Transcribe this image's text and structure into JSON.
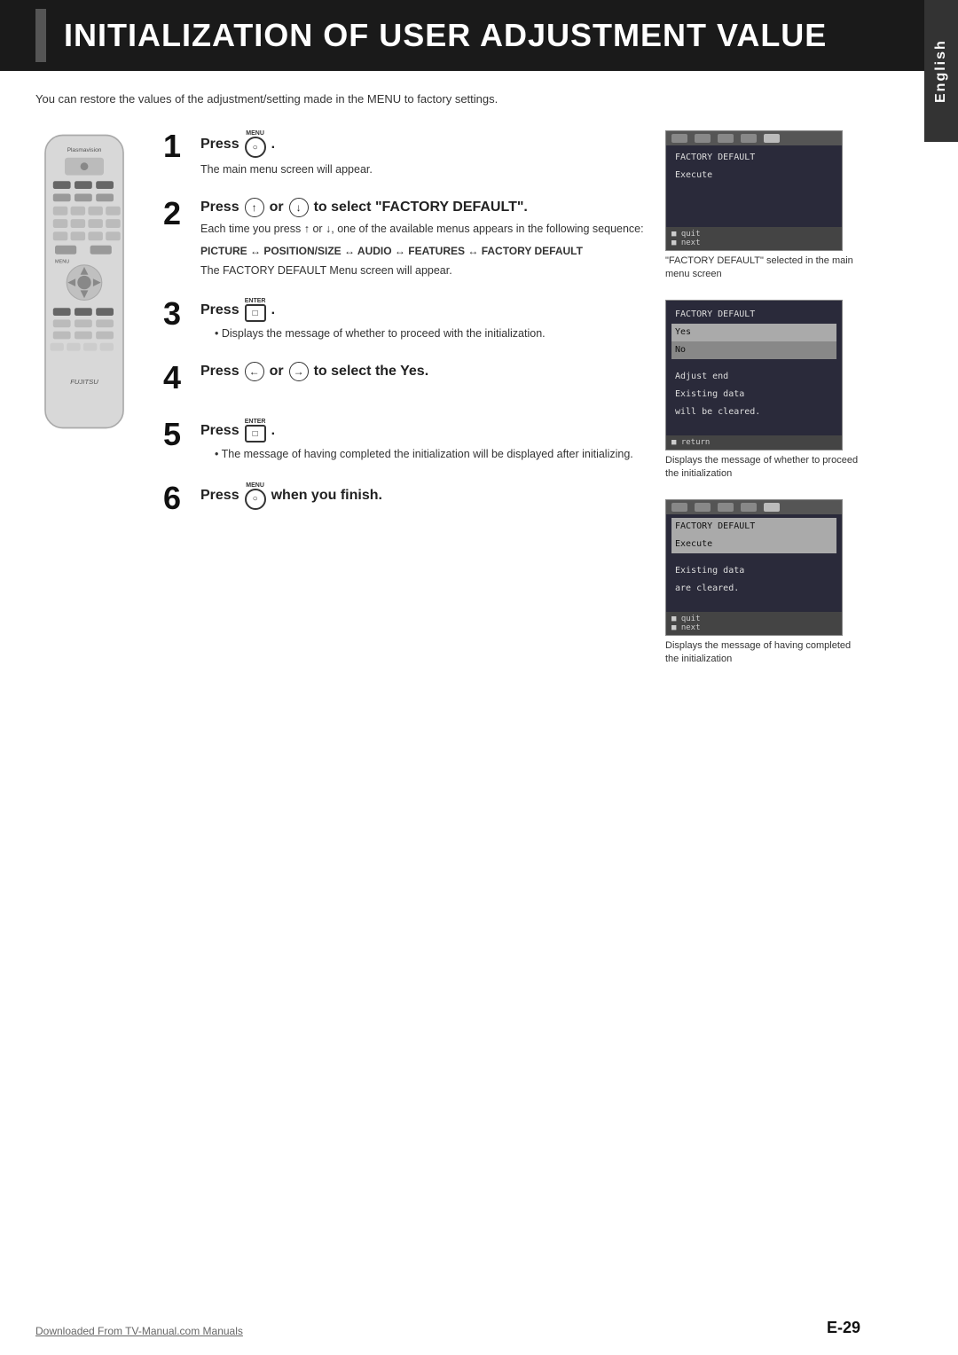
{
  "header": {
    "title": "INITIALIZATION OF USER ADJUSTMENT VALUE",
    "lang_tab": "English"
  },
  "intro": "You can restore the values of the adjustment/setting made in the MENU to factory settings.",
  "steps": [
    {
      "num": "1",
      "title_parts": [
        "Press",
        "MENU",
        "."
      ],
      "body": "The main menu screen will appear."
    },
    {
      "num": "2",
      "title_parts": [
        "Press",
        "UP",
        "or",
        "DOWN",
        "to select \"FACTORY DEFAULT\"."
      ],
      "body_lines": [
        "Each time you press ↑ or ↓, one of the available menus appears in the following sequence:",
        "PICTURE ↔ POSITION/SIZE ↔ AUDIO ↔ FEATURES ↔ FACTORY DEFAULT",
        "The FACTORY DEFAULT Menu screen will appear."
      ],
      "bold_line": "PICTURE ↔ POSITION/SIZE ↔ AUDIO ↔ FEATURES ↔ FACTORY DEFAULT"
    },
    {
      "num": "3",
      "title_parts": [
        "Press",
        "ENTER",
        "."
      ],
      "body_lines": [
        "• Displays the message of whether to proceed with the initialization."
      ]
    },
    {
      "num": "4",
      "title_parts": [
        "Press",
        "LEFT",
        "or",
        "RIGHT",
        "to select the Yes."
      ],
      "body_lines": []
    },
    {
      "num": "5",
      "title_parts": [
        "Press",
        "ENTER",
        "."
      ],
      "body_lines": [
        "• The message of having completed the initialization will be displayed after initializing."
      ]
    },
    {
      "num": "6",
      "title_parts": [
        "Press",
        "MENU",
        "when you finish."
      ],
      "body_lines": []
    }
  ],
  "screens": [
    {
      "header_dots": [
        "inactive",
        "inactive",
        "inactive",
        "inactive",
        "active"
      ],
      "rows": [
        {
          "text": "FACTORY DEFAULT",
          "style": "normal"
        },
        {
          "text": "Execute",
          "style": "normal"
        }
      ],
      "footer": [
        "quit",
        "next"
      ],
      "label": "\"FACTORY DEFAULT\" selected\nin the main menu screen"
    },
    {
      "header_dots": [],
      "rows": [
        {
          "text": "FACTORY DEFAULT",
          "style": "normal"
        },
        {
          "text": "Yes",
          "style": "highlighted"
        },
        {
          "text": "No",
          "style": "highlighted2"
        },
        {
          "text": "",
          "style": "normal"
        },
        {
          "text": "Adjust end",
          "style": "normal"
        },
        {
          "text": "Existing data",
          "style": "normal"
        },
        {
          "text": "will be cleared.",
          "style": "normal"
        }
      ],
      "footer": [
        "return"
      ],
      "label": "Displays the message of\nwhether to proceed the\ninitialization"
    },
    {
      "header_dots": [
        "inactive",
        "inactive",
        "inactive",
        "inactive",
        "active"
      ],
      "rows": [
        {
          "text": "FACTORY DEFAULT",
          "style": "normal"
        },
        {
          "text": "Execute",
          "style": "highlighted"
        },
        {
          "text": "",
          "style": "normal"
        },
        {
          "text": "Existing data",
          "style": "normal"
        },
        {
          "text": "are cleared.",
          "style": "normal"
        }
      ],
      "footer": [
        "quit",
        "next"
      ],
      "label": "Displays the message of having\ncompleted the initialization"
    }
  ],
  "footer": {
    "link": "Downloaded From TV-Manual.com Manuals",
    "page": "E-29"
  }
}
